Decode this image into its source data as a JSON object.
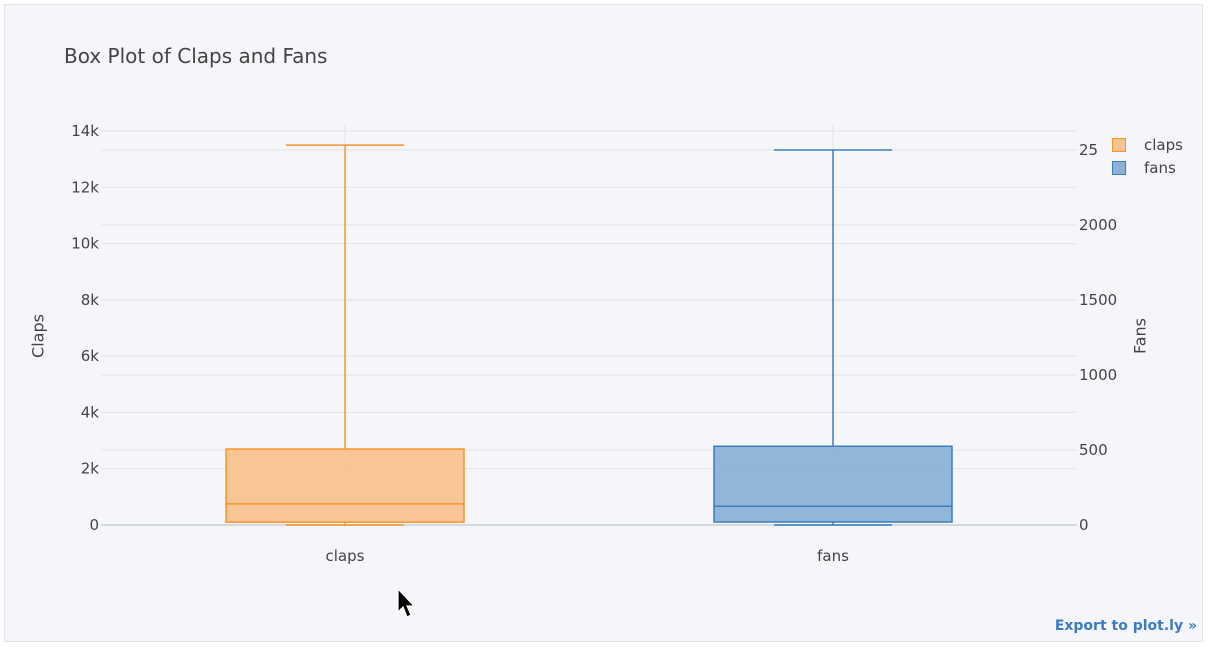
{
  "chart_data": {
    "type": "box",
    "title": "Box Plot of Claps and Fans",
    "categories": [
      "claps",
      "fans"
    ],
    "yaxis_left": {
      "label": "Claps",
      "range": [
        -100,
        14200
      ],
      "ticks": [
        0,
        2000,
        4000,
        6000,
        8000,
        10000,
        12000,
        14000
      ],
      "tick_labels": [
        "0",
        "2k",
        "4k",
        "6k",
        "8k",
        "10k",
        "12k",
        "14k"
      ]
    },
    "yaxis_right": {
      "label": "Fans",
      "range": [
        -10,
        2540
      ],
      "ticks": [
        0,
        500,
        1000,
        1500,
        2000,
        2500
      ],
      "tick_labels": [
        "0",
        "500",
        "1000",
        "1500",
        "2000",
        "25"
      ]
    },
    "series": [
      {
        "name": "claps",
        "axis": "left",
        "color": "#f5952f",
        "fill": "#f8c390",
        "min": 0,
        "q1": 100,
        "median": 750,
        "q3": 2700,
        "max": 13500
      },
      {
        "name": "fans",
        "axis": "right",
        "color": "#3b7dbd",
        "fill": "#8cb2d8",
        "min": 0,
        "q1": 20,
        "median": 125,
        "q3": 525,
        "max": 2500
      }
    ],
    "legend_position": "top-right",
    "grid": true
  },
  "legend": {
    "items": [
      {
        "label": "claps"
      },
      {
        "label": "fans"
      }
    ]
  },
  "export_link": "Export to plot.ly »"
}
